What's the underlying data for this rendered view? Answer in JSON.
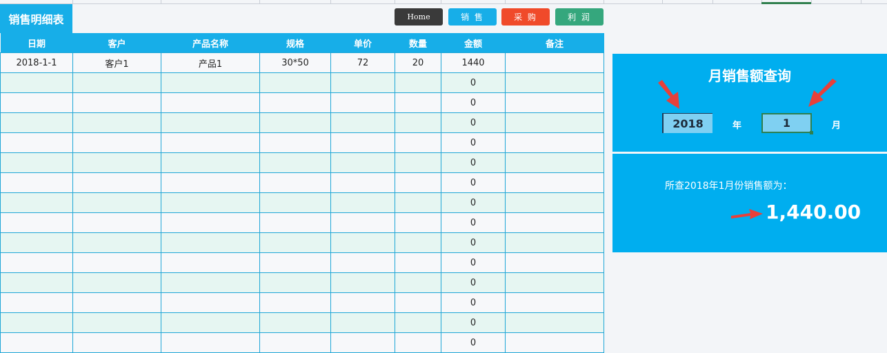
{
  "sheet_title": "销售明细表",
  "nav": [
    {
      "label": "Home",
      "color": "#3a3a3a"
    },
    {
      "label": "销 售",
      "color": "#17aee8"
    },
    {
      "label": "采 购",
      "color": "#f04a2a"
    },
    {
      "label": "利 润",
      "color": "#35a77d"
    }
  ],
  "table": {
    "headers": [
      "日期",
      "客户",
      "产品名称",
      "规格",
      "单价",
      "数量",
      "金额",
      "备注"
    ],
    "rows": [
      [
        "2018-1-1",
        "客户1",
        "产品1",
        "30*50",
        "72",
        "20",
        "1440",
        ""
      ],
      [
        "",
        "",
        "",
        "",
        "",
        "",
        "0",
        ""
      ],
      [
        "",
        "",
        "",
        "",
        "",
        "",
        "0",
        ""
      ],
      [
        "",
        "",
        "",
        "",
        "",
        "",
        "0",
        ""
      ],
      [
        "",
        "",
        "",
        "",
        "",
        "",
        "0",
        ""
      ],
      [
        "",
        "",
        "",
        "",
        "",
        "",
        "0",
        ""
      ],
      [
        "",
        "",
        "",
        "",
        "",
        "",
        "0",
        ""
      ],
      [
        "",
        "",
        "",
        "",
        "",
        "",
        "0",
        ""
      ],
      [
        "",
        "",
        "",
        "",
        "",
        "",
        "0",
        ""
      ],
      [
        "",
        "",
        "",
        "",
        "",
        "",
        "0",
        ""
      ],
      [
        "",
        "",
        "",
        "",
        "",
        "",
        "0",
        ""
      ],
      [
        "",
        "",
        "",
        "",
        "",
        "",
        "0",
        ""
      ],
      [
        "",
        "",
        "",
        "",
        "",
        "",
        "0",
        ""
      ],
      [
        "",
        "",
        "",
        "",
        "",
        "",
        "0",
        ""
      ],
      [
        "",
        "",
        "",
        "",
        "",
        "",
        "0",
        ""
      ]
    ]
  },
  "query": {
    "title": "月销售额查询",
    "year": "2018",
    "year_unit": "年",
    "month": "1",
    "month_unit": "月"
  },
  "result": {
    "label": "所查2018年1月份销售额为：",
    "value": "1,440.00"
  },
  "colors": {
    "accent": "#17aee8",
    "panel": "#00aeef",
    "arrow": "#e8403a"
  }
}
